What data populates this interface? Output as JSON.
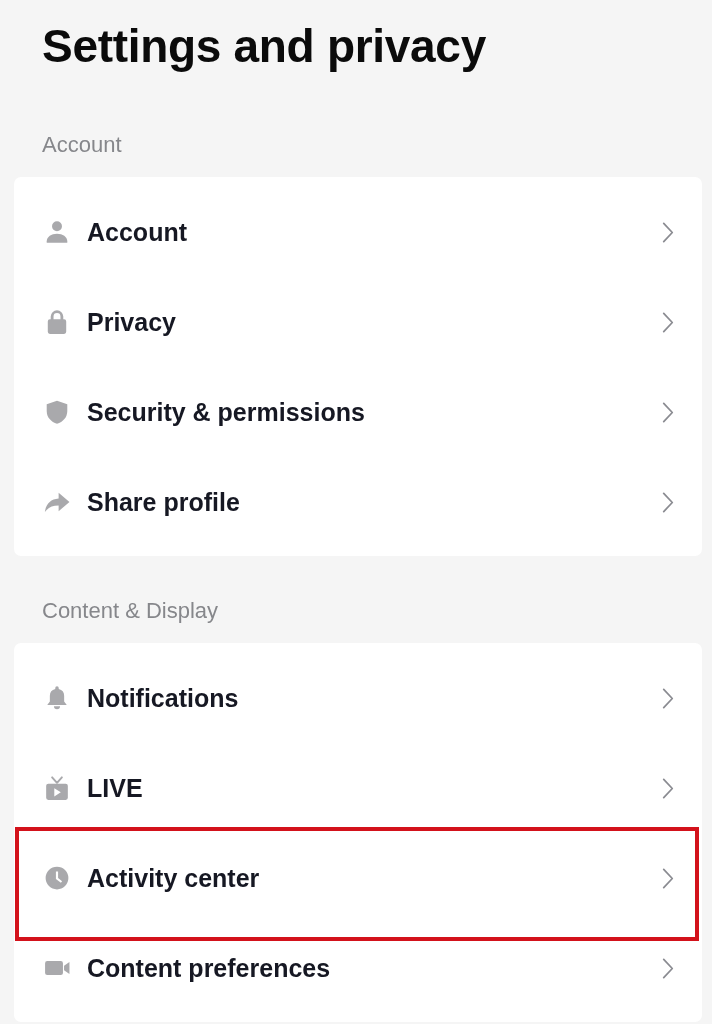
{
  "title": "Settings and privacy",
  "sections": [
    {
      "heading": "Account",
      "items": [
        {
          "label": "Account",
          "highlighted": false
        },
        {
          "label": "Privacy",
          "highlighted": false
        },
        {
          "label": "Security & permissions",
          "highlighted": false
        },
        {
          "label": "Share profile",
          "highlighted": false
        }
      ]
    },
    {
      "heading": "Content & Display",
      "items": [
        {
          "label": "Notifications",
          "highlighted": false
        },
        {
          "label": "LIVE",
          "highlighted": false
        },
        {
          "label": "Activity center",
          "highlighted": true
        },
        {
          "label": "Content preferences",
          "highlighted": false
        }
      ]
    }
  ]
}
